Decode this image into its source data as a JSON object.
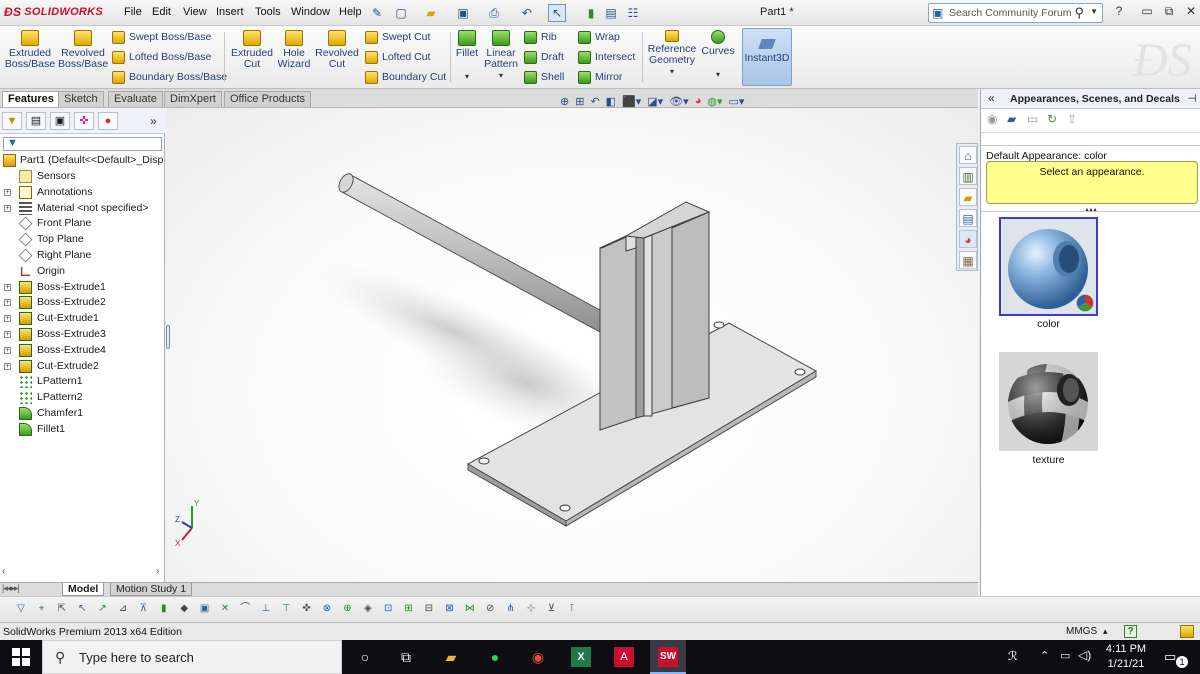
{
  "app": {
    "brand": "SOLIDWORKS",
    "doc_title": "Part1 *"
  },
  "menu": [
    "File",
    "Edit",
    "View",
    "Insert",
    "Tools",
    "Window",
    "Help"
  ],
  "search": {
    "placeholder": "Search Community Forum"
  },
  "commands": {
    "extruded_boss": "Extruded\nBoss/Base",
    "revolved_boss": "Revolved\nBoss/Base",
    "swept_boss": "Swept Boss/Base",
    "lofted_boss": "Lofted Boss/Base",
    "boundary_boss": "Boundary Boss/Base",
    "extruded_cut": "Extruded\nCut",
    "hole_wizard": "Hole\nWizard",
    "revolved_cut": "Revolved\nCut",
    "swept_cut": "Swept Cut",
    "lofted_cut": "Lofted Cut",
    "boundary_cut": "Boundary Cut",
    "fillet": "Fillet",
    "linear_pattern": "Linear\nPattern",
    "rib": "Rib",
    "draft": "Draft",
    "shell": "Shell",
    "wrap": "Wrap",
    "intersect": "Intersect",
    "mirror": "Mirror",
    "reference_geometry": "Reference\nGeometry",
    "curves": "Curves",
    "instant3d": "Instant3D"
  },
  "tabs": [
    "Features",
    "Sketch",
    "Evaluate",
    "DimXpert",
    "Office Products"
  ],
  "tree": {
    "root": "Part1  (Default<<Default>_Disp",
    "items": [
      "Sensors",
      "Annotations",
      "Material <not specified>",
      "Front Plane",
      "Top Plane",
      "Right Plane",
      "Origin",
      "Boss-Extrude1",
      "Boss-Extrude2",
      "Cut-Extrude1",
      "Boss-Extrude3",
      "Boss-Extrude4",
      "Cut-Extrude2",
      "LPattern1",
      "LPattern2",
      "Chamfer1",
      "Fillet1"
    ]
  },
  "triad": {
    "x": "X",
    "y": "Y",
    "z": "Z"
  },
  "bottom_tabs": [
    "Model",
    "Motion Study 1"
  ],
  "status": {
    "text": "SolidWorks Premium 2013 x64 Edition",
    "units": "MMGS",
    "help": "?"
  },
  "task_pane": {
    "title": "Appearances, Scenes, and Decals",
    "default_appearance": "Default Appearance: color",
    "message": "Select an appearance.",
    "swatches": [
      "color",
      "texture"
    ]
  },
  "taskbar": {
    "search_placeholder": "Type here to search",
    "time": "4:11 PM",
    "date": "1/21/21",
    "notifications": "1"
  }
}
